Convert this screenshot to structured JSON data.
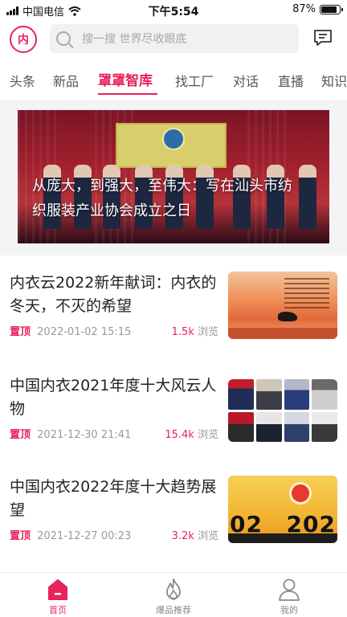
{
  "status_bar": {
    "carrier": "中国电信",
    "time": "下午5:54",
    "battery": "87%",
    "battery_level": 0.87
  },
  "header": {
    "logo_text": "内",
    "search_placeholder": "搜一搜 世界尽收眼底",
    "icons": [
      "search-icon",
      "message-icon"
    ]
  },
  "tabs": [
    {
      "label": "头条",
      "active": false
    },
    {
      "label": "新品",
      "active": false
    },
    {
      "label": "罩罩智库",
      "active": true
    },
    {
      "label": "找工厂",
      "active": false
    },
    {
      "label": "对话",
      "active": false
    },
    {
      "label": "直播",
      "active": false
    },
    {
      "label": "知识",
      "active": false
    }
  ],
  "hero": {
    "title": "从庞大，到强大，至伟大：写在汕头市纺织服装产业协会成立之日"
  },
  "articles": [
    {
      "title": "内衣云2022新年献词：内衣的冬天，不灭的希望",
      "pin": "置顶",
      "date": "2022-01-02 15:15",
      "views": "1.5k",
      "views_label": "浏览"
    },
    {
      "title": "中国内衣2021年度十大风云人物",
      "pin": "置顶",
      "date": "2021-12-30 21:41",
      "views": "15.4k",
      "views_label": "浏览"
    },
    {
      "title": "中国内衣2022年度十大趋势展望",
      "pin": "置顶",
      "date": "2021-12-27 00:23",
      "views": "3.2k",
      "views_label": "浏览",
      "thumb_left": "02",
      "thumb_right": "202"
    }
  ],
  "bottom_nav": [
    {
      "label": "首页",
      "icon": "home-icon",
      "active": true
    },
    {
      "label": "爆品推荐",
      "icon": "flame-icon",
      "active": false
    },
    {
      "label": "我的",
      "icon": "user-icon",
      "active": false
    }
  ],
  "colors": {
    "accent": "#e8225a",
    "muted": "#999999"
  }
}
